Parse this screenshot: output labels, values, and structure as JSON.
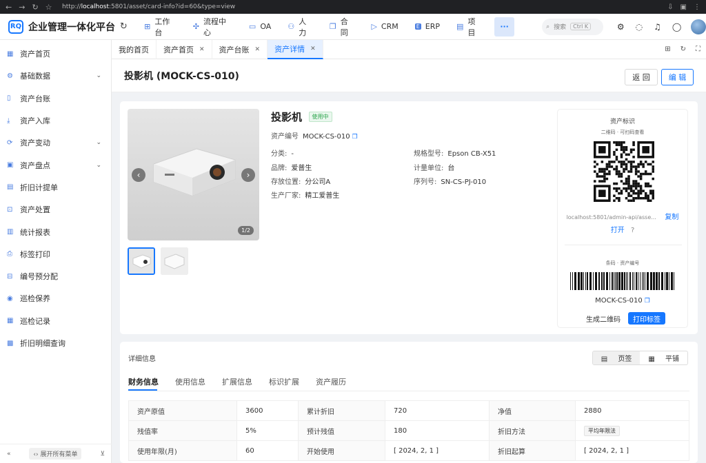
{
  "browser": {
    "url_prefix": "http://",
    "url_host": "localhost",
    "url_rest": ":5801/asset/card-info?id=60&type=view"
  },
  "app": {
    "logo_mark": "RQ",
    "name": "企业管理一体化平台"
  },
  "topnav": [
    {
      "label": "工作台",
      "icon": "grid-icon"
    },
    {
      "label": "流程中心",
      "icon": "flow-icon"
    },
    {
      "label": "OA",
      "icon": "oa-icon"
    },
    {
      "label": "人力",
      "icon": "people-icon"
    },
    {
      "label": "合同",
      "icon": "contract-icon"
    },
    {
      "label": "CRM",
      "icon": "crm-icon"
    },
    {
      "label": "ERP",
      "icon": "erp-icon"
    },
    {
      "label": "项目",
      "icon": "project-icon"
    }
  ],
  "more_label": "···",
  "search": {
    "placeholder": "搜索",
    "shortcut": "Ctrl K"
  },
  "sidebar": {
    "items": [
      {
        "label": "资产首页",
        "icon": "home-icon",
        "chev": ""
      },
      {
        "label": "基础数据",
        "icon": "gear-icon",
        "chev": "⌄"
      },
      {
        "label": "资产台账",
        "icon": "ledger-icon",
        "chev": ""
      },
      {
        "label": "资产入库",
        "icon": "download-icon",
        "chev": ""
      },
      {
        "label": "资产变动",
        "icon": "swap-icon",
        "chev": "⌄"
      },
      {
        "label": "资产盘点",
        "icon": "inventory-icon",
        "chev": "⌄"
      },
      {
        "label": "折旧计提单",
        "icon": "depreciation-icon",
        "chev": ""
      },
      {
        "label": "资产处置",
        "icon": "trash-icon",
        "chev": ""
      },
      {
        "label": "统计报表",
        "icon": "report-icon",
        "chev": ""
      },
      {
        "label": "标签打印",
        "icon": "printer-icon",
        "chev": ""
      },
      {
        "label": "编号预分配",
        "icon": "number-icon",
        "chev": ""
      },
      {
        "label": "巡检保养",
        "icon": "eye-icon",
        "chev": ""
      },
      {
        "label": "巡检记录",
        "icon": "record-icon",
        "chev": ""
      },
      {
        "label": "折旧明细查询",
        "icon": "detail-icon",
        "chev": ""
      }
    ],
    "collapse": "«",
    "expand_all": "‹› 展开所有菜单",
    "pin": "⊻"
  },
  "tabs": [
    {
      "label": "我的首页",
      "closable": false,
      "active": false
    },
    {
      "label": "资产首页",
      "closable": true,
      "active": false
    },
    {
      "label": "资产台账",
      "closable": true,
      "active": false
    },
    {
      "label": "资产详情",
      "closable": true,
      "active": true
    }
  ],
  "page": {
    "title": "投影机 (MOCK-CS-010)",
    "back": "返 回",
    "edit": "编 辑"
  },
  "asset": {
    "name": "投影机",
    "status": "使用中",
    "code_label": "资产编号",
    "code": "MOCK-CS-010",
    "category_label": "分类:",
    "category": "-",
    "brand_label": "品牌:",
    "brand": "爱普生",
    "location_label": "存放位置:",
    "location": "分公司A",
    "maker_label": "生产厂家:",
    "maker": "精工爱普生",
    "model_label": "规格型号:",
    "model": "Epson CB-X51",
    "unit_label": "计量单位:",
    "unit": "台",
    "serial_label": "序列号:",
    "serial": "SN-CS-PJ-010",
    "image_count": "1/2"
  },
  "id_panel": {
    "title": "资产标识",
    "qr_caption": "二维码 · 可扫码查看",
    "qr_url": "localhost:5801/admin-api/asse...",
    "copy": "复制",
    "open": "打开",
    "barcode_caption": "条码 · 资产编号",
    "barcode_value": "MOCK-CS-010",
    "gen_qr": "生成二维码",
    "print": "打印标签"
  },
  "details": {
    "title": "详细信息",
    "view_tabs": [
      "页签",
      "平铺"
    ],
    "tabs": [
      "财务信息",
      "使用信息",
      "扩展信息",
      "标识扩展",
      "资产履历"
    ],
    "rows": [
      [
        {
          "k": "资产原值",
          "v": "3600"
        },
        {
          "k": "累计折旧",
          "v": "720"
        },
        {
          "k": "净值",
          "v": "2880"
        }
      ],
      [
        {
          "k": "残值率",
          "v": "5%"
        },
        {
          "k": "预计残值",
          "v": "180"
        },
        {
          "k": "折旧方法",
          "v": "平均年限法"
        }
      ],
      [
        {
          "k": "使用年限(月)",
          "v": "60"
        },
        {
          "k": "开始使用",
          "v": "[ 2024, 2, 1 ]"
        },
        {
          "k": "折旧起算",
          "v": "[ 2024, 2, 1 ]"
        }
      ]
    ]
  },
  "colors": {
    "accent": "#1677ff",
    "status_green": "#2aa44b"
  }
}
